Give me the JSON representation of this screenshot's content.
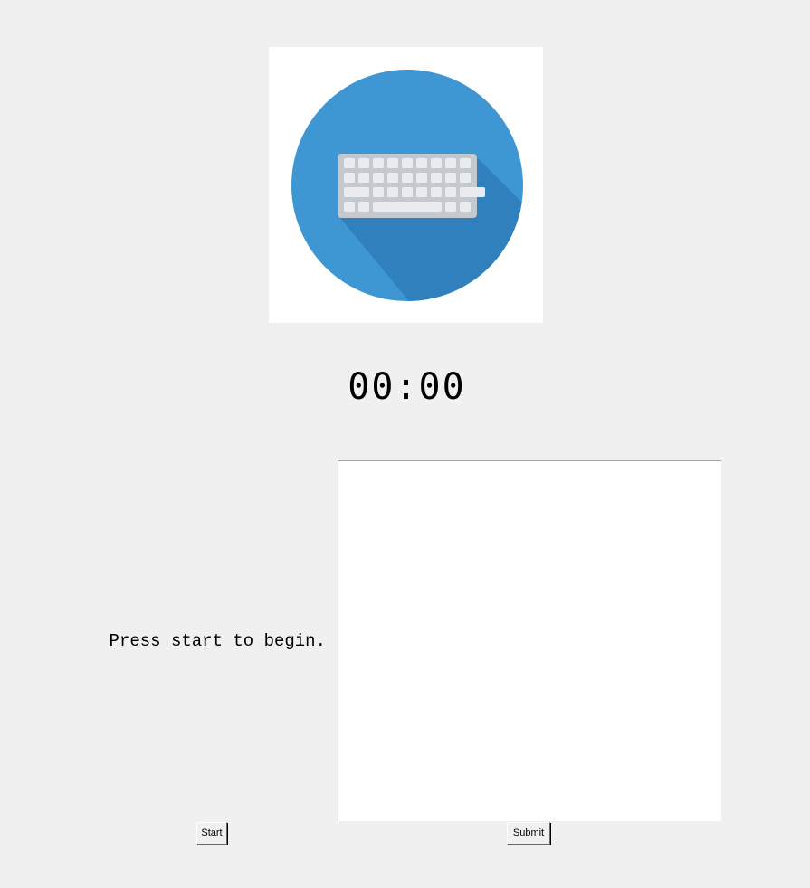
{
  "logo": {
    "icon": "keyboard-icon",
    "circle_color": "#3e97d3",
    "shadow_color": "#2f80bd",
    "keyboard_color": "#c4c8cf",
    "key_color": "#ebecef"
  },
  "timer": {
    "display": "00:00"
  },
  "prompt": {
    "text": "Press start to begin."
  },
  "typing_area": {
    "value": ""
  },
  "buttons": {
    "start_label": "Start",
    "submit_label": "Submit"
  }
}
